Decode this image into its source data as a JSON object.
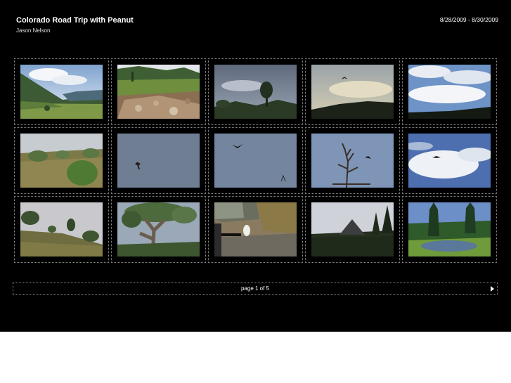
{
  "gallery": {
    "title": "Colorado Road Trip with Peanut",
    "author": "Jason Nelson",
    "date_range": "8/28/2009 - 8/30/2009"
  },
  "thumbnails": [
    {
      "subject": "mountain valley meadow"
    },
    {
      "subject": "rocky creek with willows"
    },
    {
      "subject": "storm clouds over pine tree"
    },
    {
      "subject": "bird in hazy sky over ridge"
    },
    {
      "subject": "blue sky clouds over ridge"
    },
    {
      "subject": "hillside with shrubs"
    },
    {
      "subject": "bird soaring in gray sky"
    },
    {
      "subject": "bird flying in gray sky"
    },
    {
      "subject": "bird near dead tree"
    },
    {
      "subject": "bird against clouds"
    },
    {
      "subject": "hillside with trees"
    },
    {
      "subject": "old gnarled tree"
    },
    {
      "subject": "small white dog by car"
    },
    {
      "subject": "rocky peak with pines"
    },
    {
      "subject": "pond in forest clearing"
    }
  ],
  "pager": {
    "label": "page 1 of 5"
  },
  "colors": {
    "background": "#000000",
    "page_outside": "#ffffff",
    "text": "#ffffff",
    "border": "#8a8a8a"
  }
}
